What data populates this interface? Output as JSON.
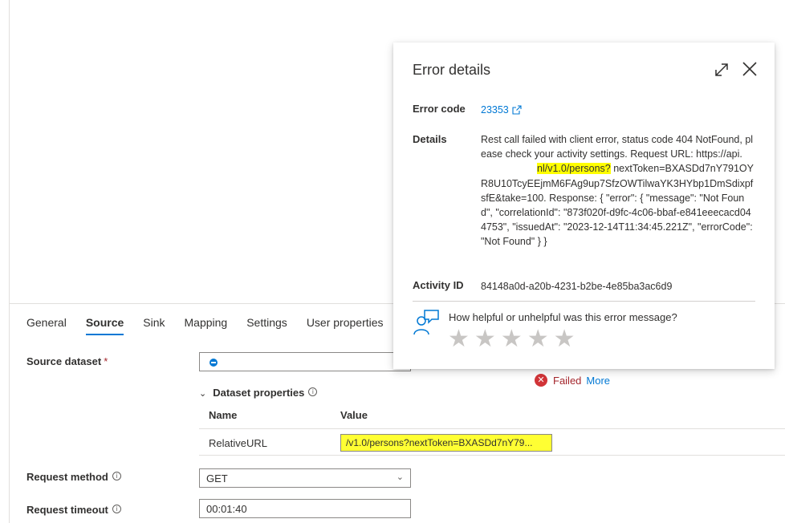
{
  "tabs": [
    {
      "label": "General"
    },
    {
      "label": "Source"
    },
    {
      "label": "Sink"
    },
    {
      "label": "Mapping"
    },
    {
      "label": "Settings"
    },
    {
      "label": "User properties"
    }
  ],
  "source": {
    "dataset_label": "Source dataset",
    "required_mark": "*",
    "dataset_props_label": "Dataset properties",
    "table": {
      "col_name": "Name",
      "col_value": "Value",
      "rows": [
        {
          "name": "RelativeURL",
          "value": "/v1.0/persons?nextToken=BXASDd7nY79..."
        }
      ]
    },
    "request_method_label": "Request method",
    "request_method_value": "GET",
    "request_timeout_label": "Request timeout",
    "request_timeout_value": "00:01:40"
  },
  "status": {
    "failed_text": "Failed",
    "more_link": "More"
  },
  "error_panel": {
    "title": "Error details",
    "error_code_label": "Error code",
    "error_code_value": "23353",
    "details_label": "Details",
    "details_part1": "Rest call failed with client error, status code 404 NotFound, please check your activity settings. Request URL: https://api.",
    "details_highlight": "nl/v1.0/persons?",
    "details_part2": "nextToken=BXASDd7nY791OYR8U10TcyEEjmM6FAg9up7SfzOWTilwaYK3HYbp1DmSdixpfsfE&take=100. Response: { \"error\": { \"message\": \"Not Found\", \"correlationId\": \"873f020f-d9fc-4c06-bbaf-e841eeecacd044753\", \"issuedAt\": \"2023-12-14T11:34:45.221Z\", \"errorCode\": \"Not Found\" } }",
    "activity_id_label": "Activity ID",
    "activity_id_value": "84148a0d-a20b-4231-b2be-4e85ba3ac6d9",
    "feedback_question": "How helpful or unhelpful was this error message?",
    "rating": 0,
    "max_rating": 5
  },
  "colors": {
    "accent": "#0078d4",
    "error": "#d13438",
    "highlight": "#ffff33"
  }
}
